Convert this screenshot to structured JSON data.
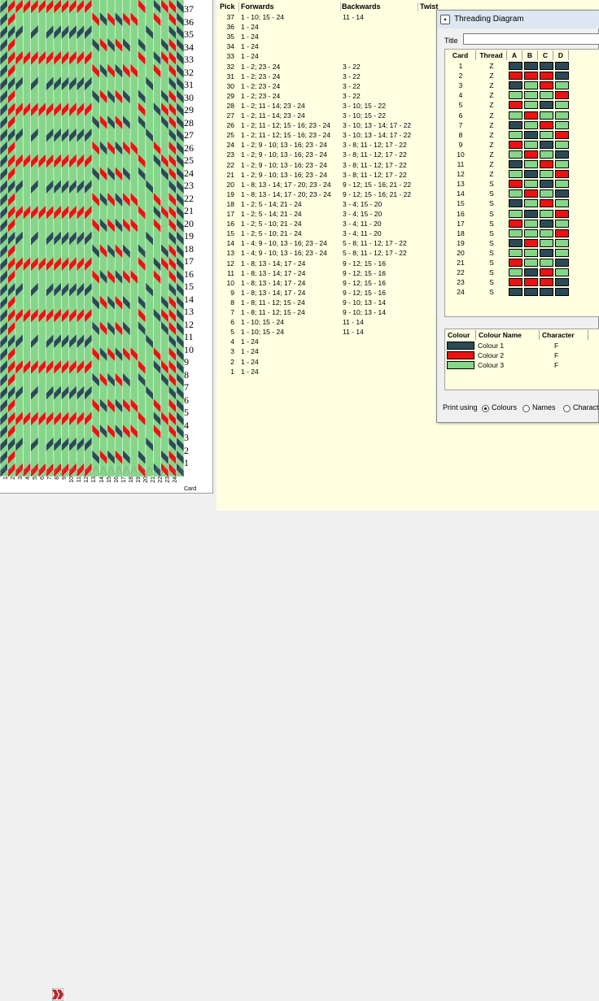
{
  "colors": {
    "dark": "#2b4a56",
    "red": "#ee1111",
    "green": "#86d68a",
    "panel_bg": "#ffffe1"
  },
  "pattern": {
    "picks": [
      "37",
      "36",
      "35",
      "34",
      "33",
      "32",
      "31",
      "30",
      "29",
      "28",
      "27",
      "26",
      "25",
      "24",
      "23",
      "22",
      "21",
      "20",
      "19",
      "18",
      "17",
      "16",
      "15",
      "14",
      "13",
      "12",
      "11",
      "10",
      "9",
      "8",
      "7",
      "6",
      "5",
      "4",
      "3",
      "2",
      "1"
    ],
    "cards": [
      "1",
      "2",
      "3",
      "4",
      "5",
      "6",
      "7",
      "8",
      "9",
      "10",
      "11",
      "12",
      "13",
      "14",
      "15",
      "16",
      "17",
      "18",
      "19",
      "20",
      "21",
      "22",
      "23",
      "24"
    ],
    "card_axis_label": "Card"
  },
  "table": {
    "headers": {
      "pick": "Pick",
      "forwards": "Forwards",
      "backwards": "Backwards",
      "twist": "Twist"
    },
    "rows": [
      {
        "pick": "37",
        "fwd": "1 - 10; 15 - 24",
        "bwd": "11 - 14"
      },
      {
        "pick": "36",
        "fwd": "1 - 24",
        "bwd": ""
      },
      {
        "pick": "35",
        "fwd": "1 - 24",
        "bwd": ""
      },
      {
        "pick": "34",
        "fwd": "1 - 24",
        "bwd": ""
      },
      {
        "pick": "33",
        "fwd": "1 - 24",
        "bwd": ""
      },
      {
        "pick": "32",
        "fwd": "1 - 2; 23 - 24",
        "bwd": "3 - 22"
      },
      {
        "pick": "31",
        "fwd": "1 - 2; 23 - 24",
        "bwd": "3 - 22"
      },
      {
        "pick": "30",
        "fwd": "1 - 2; 23 - 24",
        "bwd": "3 - 22"
      },
      {
        "pick": "29",
        "fwd": "1 - 2; 23 - 24",
        "bwd": "3 - 22"
      },
      {
        "pick": "28",
        "fwd": "1 - 2; 11 - 14; 23 - 24",
        "bwd": "3 - 10; 15 - 22"
      },
      {
        "pick": "27",
        "fwd": "1 - 2; 11 - 14; 23 - 24",
        "bwd": "3 - 10; 15 - 22"
      },
      {
        "pick": "26",
        "fwd": "1 - 2; 11 - 12; 15 - 16; 23 - 24",
        "bwd": "3 - 10; 13 - 14; 17 - 22"
      },
      {
        "pick": "25",
        "fwd": "1 - 2; 11 - 12; 15 - 16; 23 - 24",
        "bwd": "3 - 10; 13 - 14; 17 - 22"
      },
      {
        "pick": "24",
        "fwd": "1 - 2; 9 - 10; 13 - 16; 23 - 24",
        "bwd": "3 - 8; 11 - 12; 17 - 22"
      },
      {
        "pick": "23",
        "fwd": "1 - 2; 9 - 10; 13 - 16; 23 - 24",
        "bwd": "3 - 8; 11 - 12; 17 - 22"
      },
      {
        "pick": "22",
        "fwd": "1 - 2; 9 - 10; 13 - 16; 23 - 24",
        "bwd": "3 - 8; 11 - 12; 17 - 22"
      },
      {
        "pick": "21",
        "fwd": "1 - 2; 9 - 10; 13 - 16; 23 - 24",
        "bwd": "3 - 8; 11 - 12; 17 - 22"
      },
      {
        "pick": "20",
        "fwd": "1 - 8; 13 - 14; 17 - 20; 23 - 24",
        "bwd": "9 - 12; 15 - 16; 21 - 22"
      },
      {
        "pick": "19",
        "fwd": "1 - 8; 13 - 14; 17 - 20; 23 - 24",
        "bwd": "9 - 12; 15 - 16; 21 - 22"
      },
      {
        "pick": "18",
        "fwd": "1 - 2; 5 - 14; 21 - 24",
        "bwd": "3 - 4; 15 - 20"
      },
      {
        "pick": "17",
        "fwd": "1 - 2; 5 - 14; 21 - 24",
        "bwd": "3 - 4; 15 - 20"
      },
      {
        "pick": "16",
        "fwd": "1 - 2; 5 - 10; 21 - 24",
        "bwd": "3 - 4; 11 - 20"
      },
      {
        "pick": "15",
        "fwd": "1 - 2; 5 - 10; 21 - 24",
        "bwd": "3 - 4; 11 - 20"
      },
      {
        "pick": "14",
        "fwd": "1 - 4; 9 - 10; 13 - 16; 23 - 24",
        "bwd": "5 - 8; 11 - 12; 17 - 22"
      },
      {
        "pick": "13",
        "fwd": "1 - 4; 9 - 10; 13 - 16; 23 - 24",
        "bwd": "5 - 8; 11 - 12; 17 - 22"
      },
      {
        "pick": "12",
        "fwd": "1 - 8; 13 - 14; 17 - 24",
        "bwd": "9 - 12; 15 - 16"
      },
      {
        "pick": "11",
        "fwd": "1 - 8; 13 - 14; 17 - 24",
        "bwd": "9 - 12; 15 - 16"
      },
      {
        "pick": "10",
        "fwd": "1 - 8; 13 - 14; 17 - 24",
        "bwd": "9 - 12; 15 - 16"
      },
      {
        "pick": "9",
        "fwd": "1 - 8; 13 - 14; 17 - 24",
        "bwd": "9 - 12; 15 - 16"
      },
      {
        "pick": "8",
        "fwd": "1 - 8; 11 - 12; 15 - 24",
        "bwd": "9 - 10; 13 - 14"
      },
      {
        "pick": "7",
        "fwd": "1 - 8; 11 - 12; 15 - 24",
        "bwd": "9 - 10; 13 - 14"
      },
      {
        "pick": "6",
        "fwd": "1 - 10; 15 - 24",
        "bwd": "11 - 14"
      },
      {
        "pick": "5",
        "fwd": "1 - 10; 15 - 24",
        "bwd": "11 - 14"
      },
      {
        "pick": "4",
        "fwd": "1 - 24",
        "bwd": ""
      },
      {
        "pick": "3",
        "fwd": "1 - 24",
        "bwd": ""
      },
      {
        "pick": "2",
        "fwd": "1 - 24",
        "bwd": ""
      },
      {
        "pick": "1",
        "fwd": "1 - 24",
        "bwd": ""
      }
    ]
  },
  "dialog": {
    "title": "Threading Diagram",
    "title_label": "Title",
    "title_value": "",
    "card_headers": {
      "card": "Card",
      "thread": "Thread",
      "a": "A",
      "b": "B",
      "c": "C",
      "d": "D"
    },
    "cards": [
      {
        "n": "1",
        "t": "Z",
        "h": [
          "d",
          "d",
          "d",
          "d"
        ]
      },
      {
        "n": "2",
        "t": "Z",
        "h": [
          "r",
          "r",
          "r",
          "d"
        ]
      },
      {
        "n": "3",
        "t": "Z",
        "h": [
          "d",
          "g",
          "r",
          "g"
        ]
      },
      {
        "n": "4",
        "t": "Z",
        "h": [
          "g",
          "g",
          "g",
          "r"
        ]
      },
      {
        "n": "5",
        "t": "Z",
        "h": [
          "r",
          "g",
          "d",
          "g"
        ]
      },
      {
        "n": "6",
        "t": "Z",
        "h": [
          "g",
          "r",
          "g",
          "g"
        ]
      },
      {
        "n": "7",
        "t": "Z",
        "h": [
          "d",
          "g",
          "r",
          "g"
        ]
      },
      {
        "n": "8",
        "t": "Z",
        "h": [
          "g",
          "d",
          "g",
          "r"
        ]
      },
      {
        "n": "9",
        "t": "Z",
        "h": [
          "r",
          "g",
          "d",
          "g"
        ]
      },
      {
        "n": "10",
        "t": "Z",
        "h": [
          "g",
          "r",
          "g",
          "d"
        ]
      },
      {
        "n": "11",
        "t": "Z",
        "h": [
          "d",
          "g",
          "r",
          "g"
        ]
      },
      {
        "n": "12",
        "t": "Z",
        "h": [
          "g",
          "d",
          "g",
          "r"
        ]
      },
      {
        "n": "13",
        "t": "S",
        "h": [
          "r",
          "g",
          "d",
          "g"
        ]
      },
      {
        "n": "14",
        "t": "S",
        "h": [
          "g",
          "r",
          "g",
          "d"
        ]
      },
      {
        "n": "15",
        "t": "S",
        "h": [
          "d",
          "g",
          "r",
          "g"
        ]
      },
      {
        "n": "16",
        "t": "S",
        "h": [
          "g",
          "d",
          "g",
          "r"
        ]
      },
      {
        "n": "17",
        "t": "S",
        "h": [
          "r",
          "g",
          "d",
          "g"
        ]
      },
      {
        "n": "18",
        "t": "S",
        "h": [
          "g",
          "g",
          "g",
          "r"
        ]
      },
      {
        "n": "19",
        "t": "S",
        "h": [
          "d",
          "r",
          "g",
          "g"
        ]
      },
      {
        "n": "20",
        "t": "S",
        "h": [
          "g",
          "g",
          "d",
          "g"
        ]
      },
      {
        "n": "21",
        "t": "S",
        "h": [
          "r",
          "g",
          "g",
          "d"
        ]
      },
      {
        "n": "22",
        "t": "S",
        "h": [
          "g",
          "d",
          "r",
          "g"
        ]
      },
      {
        "n": "23",
        "t": "S",
        "h": [
          "r",
          "r",
          "r",
          "d"
        ]
      },
      {
        "n": "24",
        "t": "S",
        "h": [
          "d",
          "d",
          "d",
          "d"
        ]
      }
    ],
    "colour_headers": {
      "colour": "Colour",
      "name": "Colour Name",
      "character": "Character"
    },
    "colours": [
      {
        "key": "d",
        "name": "Colour 1",
        "ch": "F"
      },
      {
        "key": "r",
        "name": "Colour 2",
        "ch": "F"
      },
      {
        "key": "g",
        "name": "Colour 3",
        "ch": "F"
      }
    ],
    "print": {
      "label": "Print using",
      "options": [
        "Colours",
        "Names",
        "Characte"
      ],
      "selected": "Colours"
    }
  }
}
